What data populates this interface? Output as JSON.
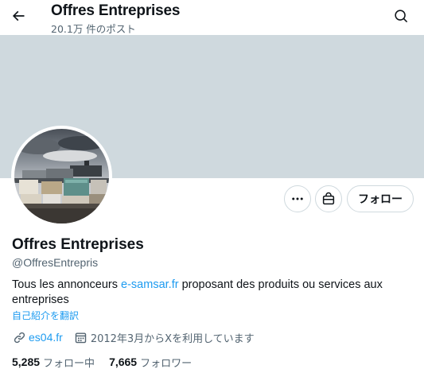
{
  "header": {
    "title": "Offres Entreprises",
    "post_count": "20.1万 件のポスト",
    "back_icon": "arrow-left-icon",
    "search_icon": "search-icon"
  },
  "profile": {
    "display_name": "Offres Entreprises",
    "handle": "@OffresEntrepris",
    "bio_prefix": "Tous les annonceurs ",
    "bio_link": "e-samsar.fr",
    "bio_suffix": " proposant des produits ou services aux entreprises",
    "translate_label": "自己紹介を翻訳",
    "website": "es04.fr",
    "joined": "2012年3月からXを利用しています",
    "following_count": "5,285",
    "following_label": "フォロー中",
    "followers_count": "7,665",
    "followers_label": "フォロワー"
  },
  "actions": {
    "more_icon": "more-icon",
    "shop_icon": "shop-icon",
    "follow_label": "フォロー"
  },
  "colors": {
    "banner": "#cfd9de",
    "link": "#1d9bf0",
    "secondary_text": "#536471",
    "primary_text": "#0f1419"
  }
}
